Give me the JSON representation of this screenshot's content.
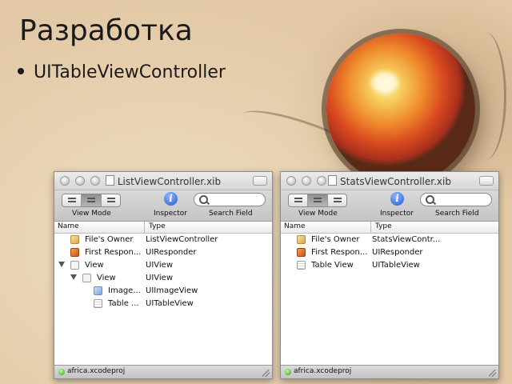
{
  "slide": {
    "title": "Разработка",
    "bullet": "UITableViewController"
  },
  "toolbar_labels": {
    "view_mode": "View Mode",
    "inspector": "Inspector",
    "search_field": "Search Field",
    "info_glyph": "i"
  },
  "columns": {
    "name": "Name",
    "type": "Type"
  },
  "windows": [
    {
      "title": "ListViewController.xib",
      "status": "africa.xcodeproj",
      "rows": [
        {
          "name": "File's Owner",
          "type": "ListViewController",
          "icon": "cube-icon"
        },
        {
          "name": "First Respon...",
          "type": "UIResponder",
          "icon": "responder-icon"
        },
        {
          "name": "View",
          "type": "UIView",
          "icon": "view-icon"
        },
        {
          "name": "View",
          "type": "UIView",
          "icon": "view-icon"
        },
        {
          "name": "Image...",
          "type": "UIImageView",
          "icon": "image-view-icon"
        },
        {
          "name": "Table ...",
          "type": "UITableView",
          "icon": "table-view-icon"
        }
      ]
    },
    {
      "title": "StatsViewController.xib",
      "status": "africa.xcodeproj",
      "rows": [
        {
          "name": "File's Owner",
          "type": "StatsViewContr...",
          "icon": "cube-icon"
        },
        {
          "name": "First Respon...",
          "type": "UIResponder",
          "icon": "responder-icon"
        },
        {
          "name": "Table View",
          "type": "UITableView",
          "icon": "table-view-icon"
        }
      ]
    }
  ],
  "colors": {
    "background": "#e8d2b2",
    "accent_info": "#1f5bd1",
    "status_ok": "#2f9f12"
  }
}
